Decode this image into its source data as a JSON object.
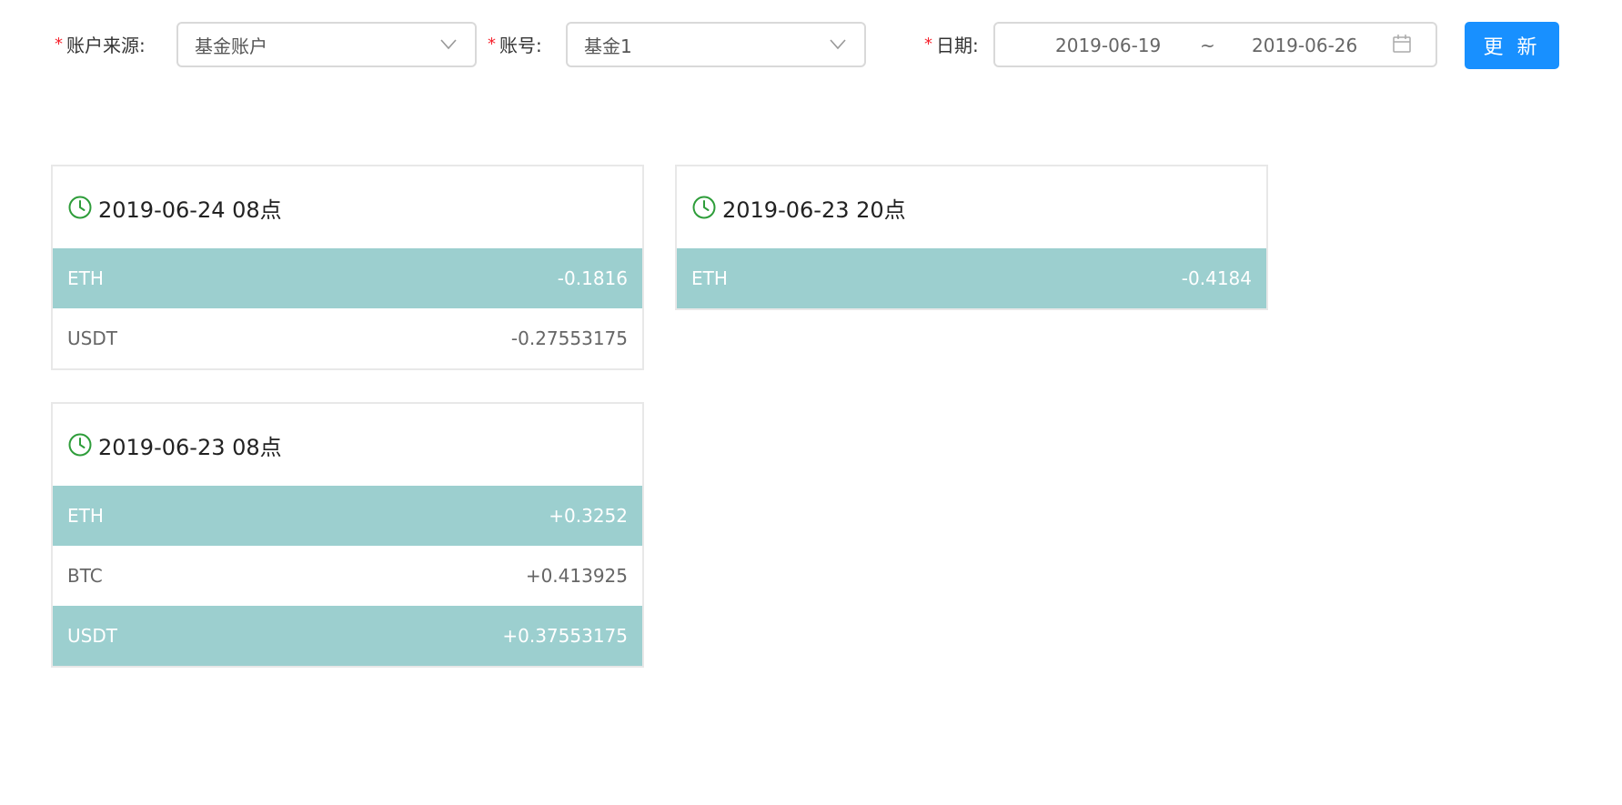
{
  "filters": {
    "account_source": {
      "required_mark": "*",
      "label": "账户来源:",
      "value": "基金账户"
    },
    "account": {
      "required_mark": "*",
      "label": "账号:",
      "value": "基金1"
    },
    "date": {
      "required_mark": "*",
      "label": "日期:",
      "start": "2019-06-19",
      "separator": "~",
      "end": "2019-06-26"
    },
    "update_button": "更 新"
  },
  "cards": [
    {
      "title": "2019-06-24 08点",
      "rows": [
        {
          "currency": "ETH",
          "value": "-0.1816"
        },
        {
          "currency": "USDT",
          "value": "-0.27553175"
        }
      ]
    },
    {
      "title": "2019-06-23 20点",
      "rows": [
        {
          "currency": "ETH",
          "value": "-0.4184"
        }
      ]
    },
    {
      "title": "2019-06-23 08点",
      "rows": [
        {
          "currency": "ETH",
          "value": "+0.3252"
        },
        {
          "currency": "BTC",
          "value": "+0.413925"
        },
        {
          "currency": "USDT",
          "value": "+0.37553175"
        }
      ]
    }
  ],
  "colors": {
    "accent": "#1890ff",
    "highlight_row": "#9ccfcf",
    "clock_icon": "#2e9d3a",
    "required": "#f5222d"
  },
  "icons": [
    "chevron-down-icon",
    "calendar-icon",
    "clock-icon"
  ]
}
